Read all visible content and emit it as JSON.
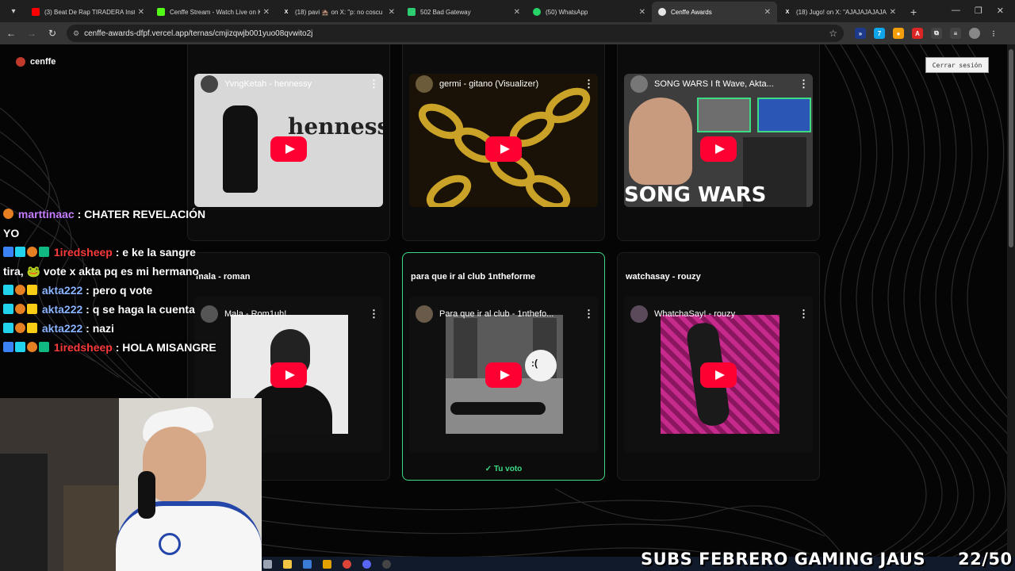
{
  "browser": {
    "tabs": [
      {
        "title": "(3) Beat De Rap TIRADERA Instr",
        "favicon_color": "#ff0000",
        "active": false
      },
      {
        "title": "Cenffe Stream - Watch Live on K",
        "favicon_color": "#53fc18",
        "active": false
      },
      {
        "title": "(18) pavi 🏚️ on X: \"p: no coscu",
        "favicon_color": "#ffffff",
        "active": false
      },
      {
        "title": "502 Bad Gateway",
        "favicon_color": "#2ecc71",
        "active": false
      },
      {
        "title": "(50) WhatsApp",
        "favicon_color": "#25d366",
        "active": false
      },
      {
        "title": "Cenffe Awards",
        "favicon_color": "#ffffff",
        "active": true
      },
      {
        "title": "(18) Jugo! on X: \"AJAJAJAJAJA",
        "favicon_color": "#ffffff",
        "active": false
      }
    ],
    "url": "cenffe-awards-dfpf.vercel.app/ternas/cmjizqwjb001yuo08qvwito2j"
  },
  "header": {
    "brand": "cenffe",
    "logout_label": "Cerrar sesión"
  },
  "cards": [
    {
      "title": "",
      "video_title": "YvngKetah - hennessy",
      "thumb_color": "#d8d8d8",
      "voted": false
    },
    {
      "title": "",
      "video_title": "germi - gitano (Visualizer)",
      "thumb_color": "#b8860b",
      "voted": false
    },
    {
      "title": "",
      "video_title": "SONG WARS I ft Wave, Akta...",
      "thumb_color": "#4a4a4a",
      "thumb_text": "SONG WARS",
      "voted": false
    },
    {
      "title": "mala - roman",
      "video_title": "Mala - Rom1uh!",
      "thumb_color": "#eaeaea",
      "voted": false
    },
    {
      "title": "para que ir al club 1ntheforme",
      "video_title": "Para que ir al club - 1nthefo...",
      "thumb_color": "#8a8a8a",
      "thumb_text": ":(",
      "voted": true,
      "vote_label": "✓ Tu voto"
    },
    {
      "title": "watchasay - rouzy",
      "video_title": "WhatchaSay! - rouzy",
      "thumb_color": "#b0207a",
      "voted": false
    }
  ],
  "chat": [
    {
      "user": "marttinaac",
      "message": ": CHATER REVELACIÓN YO"
    },
    {
      "user": "1iredsheep",
      "message": ": e ke la sangre tira, 🐸 vote x akta pq es mi hermano"
    },
    {
      "user": "akta222",
      "message": ": pero q vote"
    },
    {
      "user": "akta222",
      "message": ": q se haga la cuenta"
    },
    {
      "user": "akta222",
      "message": ": nazi"
    },
    {
      "user": "1iredsheep",
      "message": ": HOLA MISANGRE"
    }
  ],
  "overlay": {
    "subs_text": "SUBS FEBRERO GAMING JAUS",
    "subs_count": "22/50"
  },
  "colors": {
    "accent_vote": "#3ddc84",
    "youtube_red": "#ff0033"
  }
}
